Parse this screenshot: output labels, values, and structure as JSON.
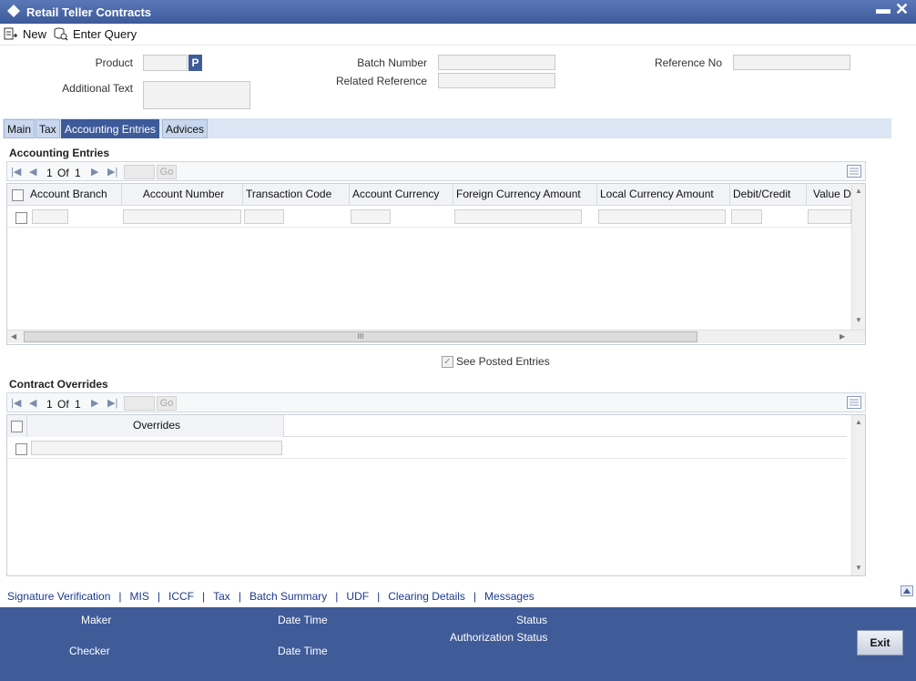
{
  "window": {
    "title": "Retail Teller Contracts"
  },
  "toolbar": {
    "new_label": "New",
    "enter_query_label": "Enter Query"
  },
  "form": {
    "product_label": "Product",
    "product_button": "P",
    "additional_text_label": "Additional Text",
    "batch_number_label": "Batch Number",
    "related_reference_label": "Related Reference",
    "reference_no_label": "Reference No"
  },
  "tabs": [
    "Main",
    "Tax",
    "Accounting Entries",
    "Advices"
  ],
  "accounting": {
    "title": "Accounting Entries",
    "pager": {
      "current": "1",
      "of_label": "Of",
      "total": "1",
      "go_label": "Go"
    },
    "columns": [
      "Account Branch",
      "Account Number",
      "Transaction Code",
      "Account Currency",
      "Foreign Currency Amount",
      "Local Currency Amount",
      "Debit/Credit",
      "Value D"
    ],
    "hscroll_grip": "III"
  },
  "see_posted_entries_label": "See Posted Entries",
  "overrides": {
    "title": "Contract Overrides",
    "pager": {
      "current": "1",
      "of_label": "Of",
      "total": "1",
      "go_label": "Go"
    },
    "columns": [
      "Overrides"
    ]
  },
  "links": [
    "Signature Verification",
    "MIS",
    "ICCF",
    "Tax",
    "Batch Summary",
    "UDF",
    "Clearing Details",
    "Messages"
  ],
  "footer": {
    "maker_label": "Maker",
    "checker_label": "Checker",
    "date_time_label": "Date Time",
    "status_label": "Status",
    "authorization_status_label": "Authorization Status",
    "exit_label": "Exit"
  },
  "colors": {
    "accent": "#3f5b98",
    "link": "#1c3a8a"
  }
}
